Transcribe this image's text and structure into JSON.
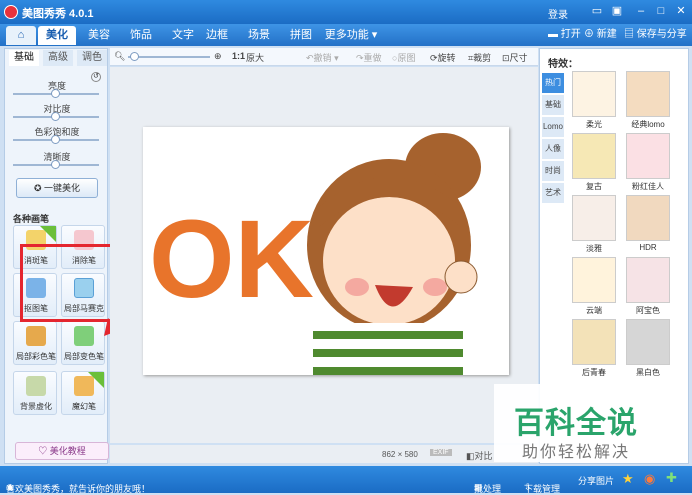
{
  "app": {
    "title": "美图秀秀 4.0.1",
    "login": "登录"
  },
  "header_buttons": {
    "open": "打开",
    "new": "新建",
    "save_share": "保存与分享"
  },
  "tabs": [
    "美化",
    "美容",
    "饰品",
    "文字",
    "边框",
    "场景",
    "拼图",
    "更多功能"
  ],
  "left": {
    "subtabs": [
      "基础",
      "高级",
      "调色"
    ],
    "sliders": [
      "亮度",
      "对比度",
      "色彩饱和度",
      "清晰度"
    ],
    "one_click": "一键美化",
    "brush_title": "各种画笔",
    "brushes": [
      "消斑笔",
      "消除笔",
      "抠图笔",
      "局部马赛克",
      "局部彩色笔",
      "局部变色笔",
      "背景虚化",
      "魔幻笔"
    ],
    "tutorial": "美化教程"
  },
  "toolbar": {
    "original": "原大",
    "ratio": "1:1",
    "undo": "撤销",
    "redo": "重做",
    "revert": "原图",
    "rotate": "旋转",
    "crop": "裁剪",
    "size": "尺寸"
  },
  "image_text": "OK",
  "status": {
    "dims": "862 × 580",
    "compare": "对比"
  },
  "effects": {
    "title": "特效：",
    "categories": [
      "热门",
      "基础",
      "Lomo",
      "人像",
      "时尚",
      "艺术"
    ],
    "items": [
      "柔光",
      "经典lomo",
      "复古",
      "粉红佳人",
      "淡雅",
      "HDR",
      "云端",
      "阿宝色",
      "后青春",
      "黑白色"
    ]
  },
  "footer": {
    "welcome": "喜欢美图秀秀，就告诉你的朋友哦！",
    "batch": "批处理",
    "download": "下载管理",
    "share": "分享图片"
  },
  "watermark": {
    "big": "百科全说",
    "small": "助你轻松解决"
  },
  "colors": {
    "accent": "#2371c7",
    "highlight": "#e4262f",
    "ok_orange": "#e8742b"
  }
}
